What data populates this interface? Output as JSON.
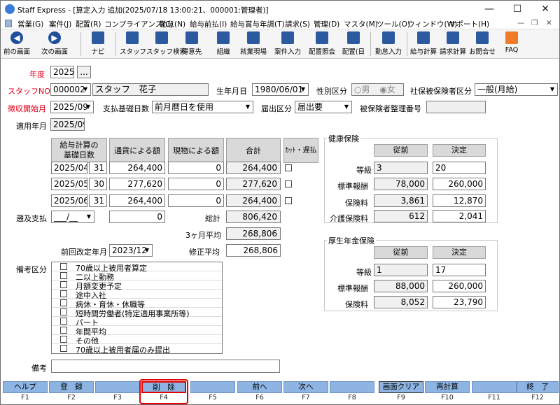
{
  "titlebar": {
    "title": "Staff Express - [算定入力 追加(2025/07/18 13:00:21、000001:管理者)]",
    "min": "—",
    "max": "☐",
    "close": "✕"
  },
  "menubar": {
    "items": [
      "営業(G)",
      "案件(J)",
      "配置(R)",
      "コンプライアンス(C)",
      "勤怠(N)",
      "給与前払(I)",
      "給与賞与年調(T)",
      "請求(S)",
      "管理(D)",
      "マスタ(M)",
      "ツール(O)",
      "ウィンドウ(W)",
      "サポート(H)"
    ],
    "controls": [
      "—",
      "❐",
      "✕"
    ]
  },
  "toolbar": {
    "buttons": [
      "前の画面",
      "次の画面",
      "ナビ",
      "スタッフ",
      "スタッフ検索",
      "得意先",
      "組織",
      "就業現場",
      "案件入力",
      "配置照会",
      "配置(日",
      "勤怠入力",
      "給与計算",
      "請求計算",
      "お問合せ",
      "FAQ"
    ]
  },
  "form": {
    "nendo_label": "年度",
    "nendo": "2025",
    "nendo_btn": "...",
    "staff_label": "スタッフNO",
    "staff_no": "000002",
    "staff_name": "スタッフ　花子",
    "birth_label": "生年月日",
    "birth": "1980/06/01",
    "gender_label": "性別区分",
    "gender_m": "男",
    "gender_f": "女",
    "shaho_label": "社保被保険者区分",
    "shaho": "一般(月給)",
    "choshu_label": "徴収開始月",
    "choshu": "2025/09",
    "shiharai_label": "支払基礎日数",
    "shiharai": "前月暦日を使用",
    "todoke_label": "届出区分",
    "todoke": "届出要",
    "seiri_label": "被保険者整理番号",
    "tekiyo_label": "適用年月",
    "tekiyo": "2025/09"
  },
  "calc_table": {
    "headers": [
      "給与計算の\n基礎日数",
      "通貨による額",
      "現物による額",
      "合計",
      "ｶｯﾄ・遅払"
    ],
    "rows": [
      {
        "month": "2025/04",
        "days": "31",
        "cash": "264,400",
        "kind": "0",
        "total": "264,400"
      },
      {
        "month": "2025/05",
        "days": "30",
        "cash": "277,620",
        "kind": "0",
        "total": "277,620"
      },
      {
        "month": "2025/06",
        "days": "31",
        "cash": "264,400",
        "kind": "0",
        "total": "264,400"
      }
    ],
    "sokyu_label": "遡及支払",
    "sokyu_date": "___/__",
    "sokyu_val": "0",
    "sokei_label": "総計",
    "sokei": "806,420",
    "avg_label": "3ヶ月平均",
    "avg": "268,806",
    "prev_label": "前回改定年月",
    "prev": "2023/12",
    "shusei_label": "修正平均",
    "shusei": "268,806"
  },
  "bikou": {
    "label": "備考区分",
    "items": [
      "70歳以上被用者算定",
      "二以上勤務",
      "月額変更予定",
      "途中入社",
      "病休・育休・休職等",
      "短時間労働者(特定適用事業所等)",
      "パート",
      "年間平均",
      "その他",
      "70歳以上被用者届のみ提出"
    ],
    "memo_label": "備考"
  },
  "kenpo": {
    "title": "健康保険",
    "col_before": "従前",
    "col_after": "決定",
    "rows": [
      {
        "label": "等級",
        "before": "3",
        "after": "20"
      },
      {
        "label": "標準報酬",
        "before": "78,000",
        "after": "260,000"
      },
      {
        "label": "保険料",
        "before": "3,861",
        "after": "12,870"
      },
      {
        "label": "介護保険料",
        "before": "612",
        "after": "2,041"
      }
    ]
  },
  "kosei": {
    "title": "厚生年金保険",
    "col_before": "従前",
    "col_after": "決定",
    "rows": [
      {
        "label": "等級",
        "before": "1",
        "after": "17"
      },
      {
        "label": "標準報酬",
        "before": "88,000",
        "after": "260,000"
      },
      {
        "label": "保険料",
        "before": "8,052",
        "after": "23,790"
      }
    ]
  },
  "fkeys": [
    {
      "label": "ヘルプ",
      "key": "F1"
    },
    {
      "label": "登　録",
      "key": "F2"
    },
    {
      "label": "",
      "key": "F3"
    },
    {
      "label": "削　除",
      "key": "F4"
    },
    {
      "label": "",
      "key": "F5"
    },
    {
      "label": "前へ",
      "key": "F6"
    },
    {
      "label": "次へ",
      "key": "F7"
    },
    {
      "label": "",
      "key": "F8"
    },
    {
      "label": "画面クリア",
      "key": "F9"
    },
    {
      "label": "再計算",
      "key": "F10"
    },
    {
      "label": "",
      "key": "F11"
    },
    {
      "label": "終　了",
      "key": "F12"
    }
  ],
  "colors": {
    "red_label": "#e0001a",
    "fkey": "#8db4e2",
    "highlight": "#e00000",
    "header": "#d9d9d9"
  }
}
